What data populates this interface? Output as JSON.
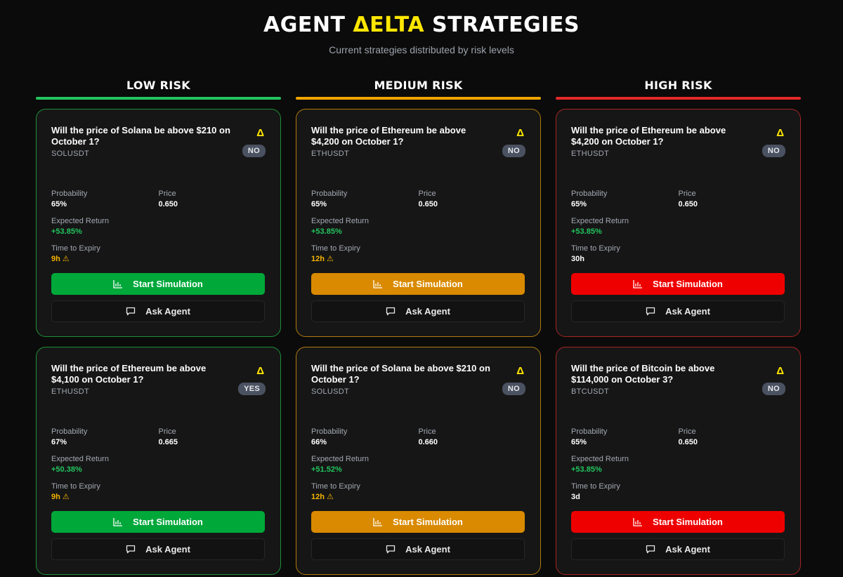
{
  "header": {
    "title_pre": "AGENT ",
    "title_accent": "ΔELTA",
    "title_post": " STRATEGIES",
    "subtitle": "Current strategies distributed by risk levels"
  },
  "colors": {
    "accent": "#ffe600",
    "low": "#22c55e",
    "medium": "#f0a500",
    "high": "#e32929"
  },
  "labels": {
    "probability": "Probability",
    "price": "Price",
    "expected_return": "Expected Return",
    "time_to_expiry": "Time to Expiry",
    "start_simulation": "Start Simulation",
    "ask_agent": "Ask Agent",
    "delta_icon": "Δ",
    "warning_icon": "⚠"
  },
  "icons": {
    "delta": "delta-icon",
    "chart": "bar-chart-icon",
    "chat": "chat-bubble-icon",
    "warning": "warning-icon"
  },
  "columns": [
    {
      "title": "LOW RISK",
      "cards": [
        {
          "question": "Will the price of Solana be above $210 on October 1?",
          "symbol": "SOLUSDT",
          "badge": "NO",
          "probability": "65%",
          "price": "0.650",
          "expected_return": "+53.85%",
          "expiry": "9h"
        },
        {
          "question": "Will the price of Ethereum be above $4,100 on October 1?",
          "symbol": "ETHUSDT",
          "badge": "YES",
          "probability": "67%",
          "price": "0.665",
          "expected_return": "+50.38%",
          "expiry": "9h"
        }
      ]
    },
    {
      "title": "MEDIUM RISK",
      "cards": [
        {
          "question": "Will the price of Ethereum be above $4,200 on October 1?",
          "symbol": "ETHUSDT",
          "badge": "NO",
          "probability": "65%",
          "price": "0.650",
          "expected_return": "+53.85%",
          "expiry": "12h"
        },
        {
          "question": "Will the price of Solana be above $210 on October 1?",
          "symbol": "SOLUSDT",
          "badge": "NO",
          "probability": "66%",
          "price": "0.660",
          "expected_return": "+51.52%",
          "expiry": "12h"
        }
      ]
    },
    {
      "title": "HIGH RISK",
      "cards": [
        {
          "question": "Will the price of Ethereum be above $4,200 on October 1?",
          "symbol": "ETHUSDT",
          "badge": "NO",
          "probability": "65%",
          "price": "0.650",
          "expected_return": "+53.85%",
          "expiry": "30h"
        },
        {
          "question": "Will the price of Bitcoin be above $114,000 on October 3?",
          "symbol": "BTCUSDT",
          "badge": "NO",
          "probability": "65%",
          "price": "0.650",
          "expected_return": "+53.85%",
          "expiry": "3d"
        }
      ]
    }
  ]
}
